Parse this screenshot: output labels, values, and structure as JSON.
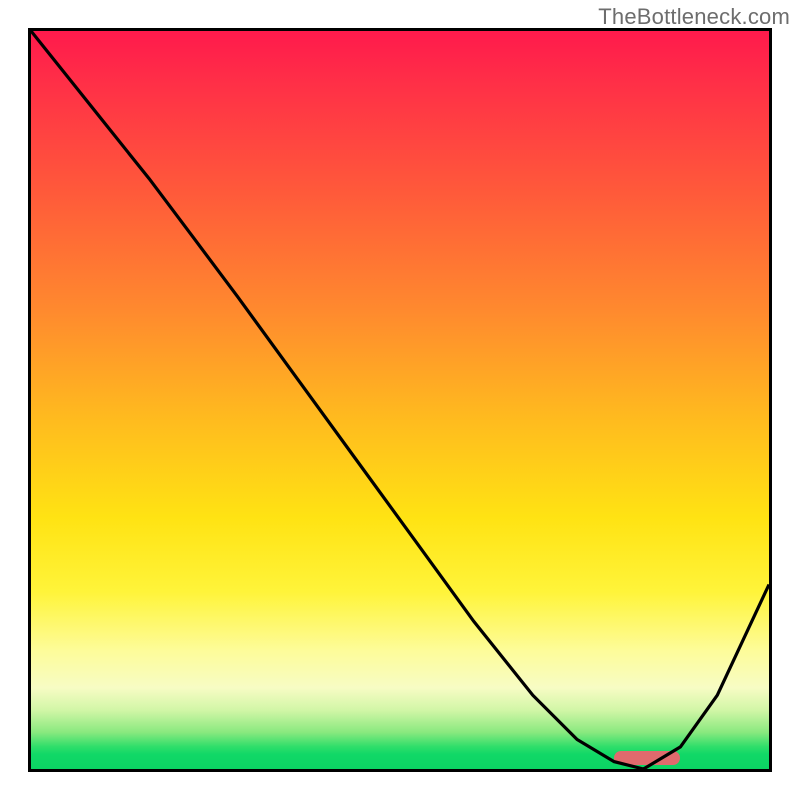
{
  "watermark": "TheBottleneck.com",
  "colors": {
    "border": "#000000",
    "watermark_text": "#6d6d6d",
    "pill": "#e06a6d",
    "curve": "#000000",
    "gradient_stops": [
      "#ff1a4c",
      "#ff2f47",
      "#ff5a3a",
      "#ff8a2e",
      "#ffb91f",
      "#ffe313",
      "#fff43a",
      "#fdfc9a",
      "#f7fcc4",
      "#d2f6a7",
      "#8ae97f",
      "#2ede6a",
      "#11d867",
      "#0bd463"
    ]
  },
  "chart_data": {
    "type": "line",
    "title": "",
    "xlabel": "",
    "ylabel": "",
    "xlim": [
      0,
      100
    ],
    "ylim": [
      0,
      100
    ],
    "grid": false,
    "legend": false,
    "note": "y=100 is poor (red), y=0 is optimal (green). Values estimated from pixel positions; x is percent of chart width.",
    "series": [
      {
        "name": "bottleneck-curve",
        "x": [
          0,
          8,
          16,
          22,
          28,
          36,
          44,
          52,
          60,
          68,
          74,
          79,
          83,
          88,
          93,
          100
        ],
        "y": [
          100,
          90,
          80,
          72,
          64,
          53,
          42,
          31,
          20,
          10,
          4,
          1,
          0,
          3,
          10,
          25
        ]
      }
    ],
    "optimal_range_x": [
      79,
      88
    ],
    "pill": {
      "x_start": 79,
      "x_end": 88,
      "y": 1.5
    }
  }
}
